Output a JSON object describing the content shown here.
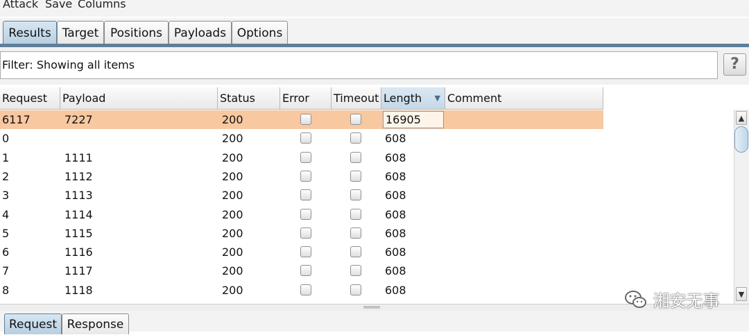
{
  "menu": [
    "Attack",
    "Save",
    "Columns"
  ],
  "tabs": [
    "Results",
    "Target",
    "Positions",
    "Payloads",
    "Options"
  ],
  "active_tab": "Results",
  "filter": {
    "label": "Filter: Showing all items",
    "help": "?"
  },
  "table": {
    "columns": [
      "Request",
      "Payload",
      "Status",
      "Error",
      "Timeout",
      "Length",
      "Comment"
    ],
    "sorted_column": "Length",
    "sort_indicator": "▼",
    "rows": [
      {
        "request": "6117",
        "payload": "7227",
        "status": "200",
        "length": "16905",
        "comment": "",
        "selected": true
      },
      {
        "request": "0",
        "payload": "",
        "status": "200",
        "length": "608",
        "comment": ""
      },
      {
        "request": "1",
        "payload": "1111",
        "status": "200",
        "length": "608",
        "comment": ""
      },
      {
        "request": "2",
        "payload": "1112",
        "status": "200",
        "length": "608",
        "comment": ""
      },
      {
        "request": "3",
        "payload": "1113",
        "status": "200",
        "length": "608",
        "comment": ""
      },
      {
        "request": "4",
        "payload": "1114",
        "status": "200",
        "length": "608",
        "comment": ""
      },
      {
        "request": "5",
        "payload": "1115",
        "status": "200",
        "length": "608",
        "comment": ""
      },
      {
        "request": "6",
        "payload": "1116",
        "status": "200",
        "length": "608",
        "comment": ""
      },
      {
        "request": "7",
        "payload": "1117",
        "status": "200",
        "length": "608",
        "comment": ""
      },
      {
        "request": "8",
        "payload": "1118",
        "status": "200",
        "length": "608",
        "comment": ""
      }
    ]
  },
  "bottom_tabs": [
    "Request",
    "Response"
  ],
  "active_bottom_tab": "Request",
  "watermark": "湘安无事",
  "colors": {
    "selected_row": "#f8c8a0",
    "active_tab": "#b7cfe1",
    "accent": "#5f7f99"
  }
}
